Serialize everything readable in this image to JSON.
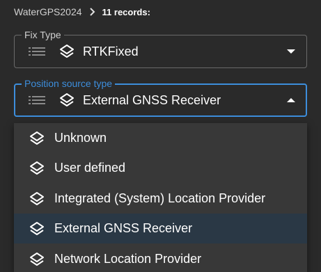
{
  "breadcrumb": {
    "root": "WaterGPS2024",
    "current": "11 records:"
  },
  "fix_type": {
    "label": "Fix Type",
    "value": "RTKFixed",
    "icon": "layers-icon",
    "state": "collapsed"
  },
  "position_source": {
    "label": "Position source type",
    "value": "External GNSS Receiver",
    "icon": "layers-icon",
    "state": "expanded",
    "accent_color": "#3d8edc"
  },
  "menu": {
    "items": [
      {
        "label": "Unknown",
        "selected": false
      },
      {
        "label": "User defined",
        "selected": false
      },
      {
        "label": "Integrated (System) Location Provider",
        "selected": false
      },
      {
        "label": "External GNSS Receiver",
        "selected": true
      },
      {
        "label": "Network Location Provider",
        "selected": false
      }
    ],
    "selected_color": "#2a3845"
  },
  "colors": {
    "background": "#2a2a2a",
    "menu_background": "#383838",
    "border": "#6a6a6a"
  }
}
